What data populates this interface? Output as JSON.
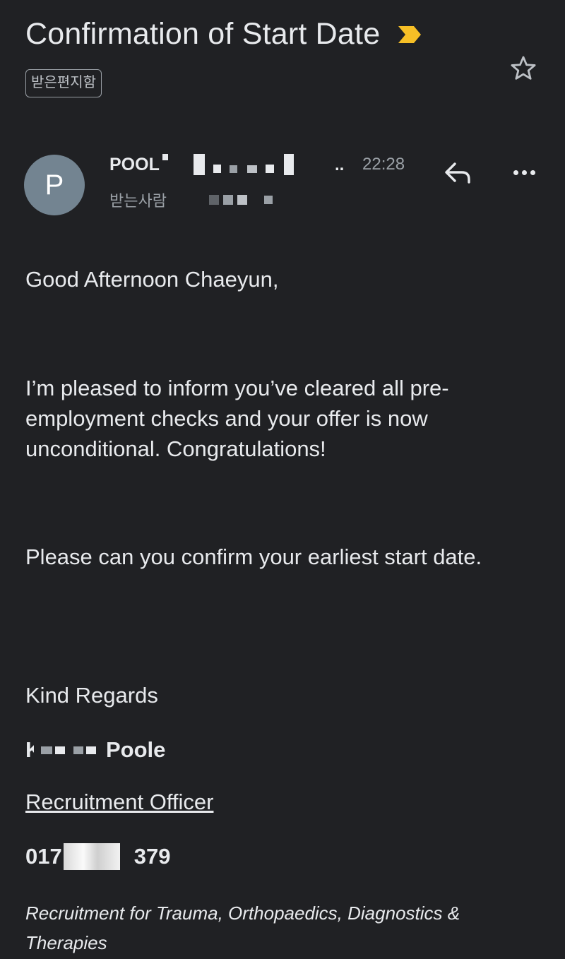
{
  "email": {
    "subject": "Confirmation of Start Date",
    "label": "받은편지함",
    "sender": {
      "avatar_letter": "P",
      "name_visible": "POOL",
      "time": "22:28",
      "ellipsis": "..",
      "to_label": "받는사람"
    },
    "body": {
      "greeting": "Good Afternoon Chaeyun,",
      "paragraph1": "I’m pleased to inform you’ve cleared all pre-employment checks and your offer is now unconditional. Congratulations!",
      "paragraph2": "Please can you confirm your earliest start date.",
      "closing": "Kind Regards"
    },
    "signature": {
      "first_initial": "K",
      "last_name": "Poole",
      "role": "Recruitment Officer",
      "phone_start": "017",
      "phone_end": "379",
      "department": "Recruitment for Trauma, Orthopaedics, Diagnostics & Therapies"
    }
  },
  "icons": {
    "importance": "importance-marker-icon",
    "star": "star-icon",
    "reply": "reply-icon",
    "more": "more-options-icon"
  },
  "colors": {
    "background": "#202124",
    "importance": "#f6bf26",
    "avatar": "#738491"
  }
}
